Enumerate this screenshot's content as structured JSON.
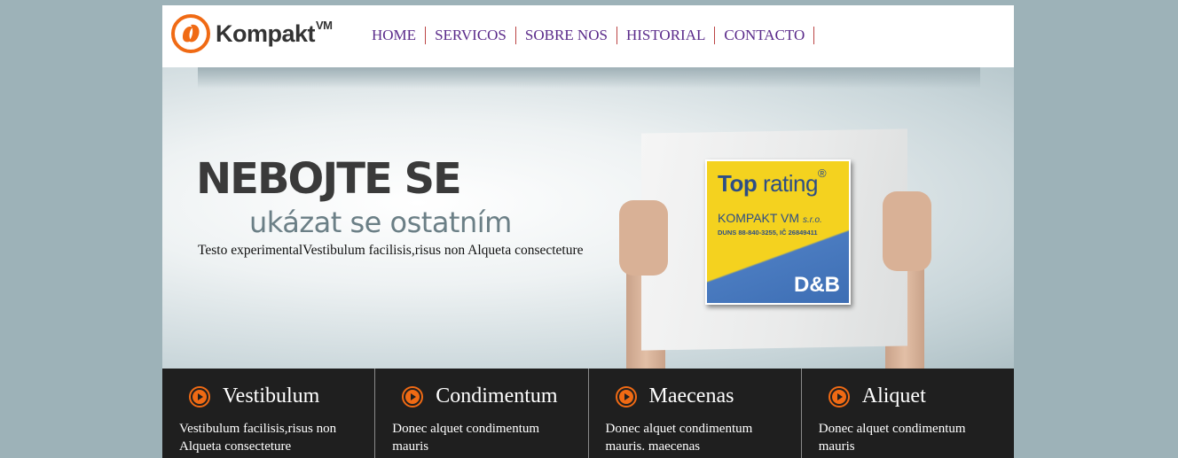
{
  "header": {
    "logo_text": "Kompakt",
    "logo_sup": "VM",
    "nav": [
      "HOME",
      "SERVICOS",
      "SOBRE NOS",
      "HISTORIAL",
      "CONTACTO"
    ]
  },
  "hero": {
    "title": "NEBOJTE SE",
    "subtitle": "ukázat se ostatním",
    "text": "Testo experimentalVestibulum facilisis,risus non Alqueta consecteture",
    "badge": {
      "title_bold": "Top",
      "title_rest": " rating",
      "reg": "®",
      "company": "KOMPAKT VM",
      "company_suffix": "s.r.o.",
      "duns": "DUNS 88-840-3255, IČ 26849411",
      "brand": "D&B"
    }
  },
  "features": [
    {
      "title": "Vestibulum",
      "text": "Vestibulum facilisis,risus non Alqueta consecteture"
    },
    {
      "title": "Condimentum",
      "text": "Donec alquet condimentum mauris"
    },
    {
      "title": "Maecenas",
      "text": "Donec alquet condimentum mauris. maecenas"
    },
    {
      "title": "Aliquet",
      "text": "Donec alquet condimentum mauris"
    }
  ],
  "colors": {
    "background": "#9db2b8",
    "accent": "#f06a14",
    "nav_text": "#5a2a8a",
    "feature_bg": "#1f1f1f"
  }
}
